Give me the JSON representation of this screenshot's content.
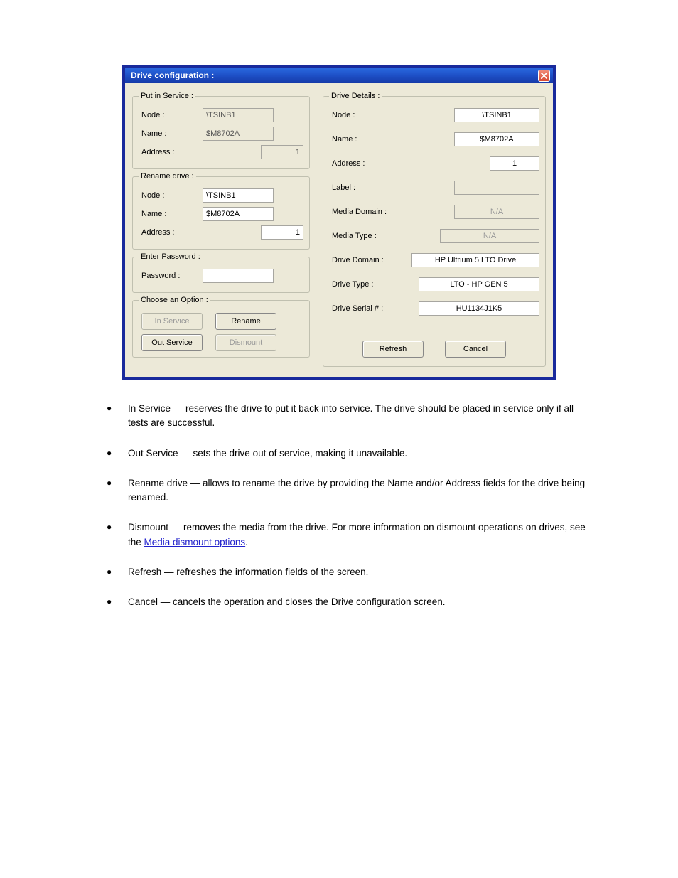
{
  "dialog": {
    "title": "Drive configuration :",
    "putInService": {
      "legend": "Put in Service :",
      "nodeLabel": "Node :",
      "nodeValue": "\\TSINB1",
      "nameLabel": "Name :",
      "nameValue": "$M8702A",
      "addressLabel": "Address :",
      "addressValue": "1"
    },
    "renameDrive": {
      "legend": "Rename drive :",
      "nodeLabel": "Node :",
      "nodeValue": "\\TSINB1",
      "nameLabel": "Name :",
      "nameValue": "$M8702A",
      "addressLabel": "Address :",
      "addressValue": "1"
    },
    "enterPassword": {
      "legend": "Enter Password :",
      "passwordLabel": "Password :",
      "passwordValue": ""
    },
    "chooseOption": {
      "legend": "Choose an Option :",
      "inService": "In Service",
      "rename": "Rename",
      "outService": "Out Service",
      "dismount": "Dismount"
    },
    "driveDetails": {
      "legend": "Drive Details :",
      "nodeLabel": "Node :",
      "nodeValue": "\\TSINB1",
      "nameLabel": "Name :",
      "nameValue": "$M8702A",
      "addressLabel": "Address :",
      "addressValue": "1",
      "labelLabel": "Label :",
      "labelValue": "",
      "mediaDomainLabel": "Media Domain :",
      "mediaDomainValue": "N/A",
      "mediaTypeLabel": "Media Type :",
      "mediaTypeValue": "N/A",
      "driveDomainLabel": "Drive Domain :",
      "driveDomainValue": "HP Ultrium 5 LTO Drive",
      "driveTypeLabel": "Drive Type :",
      "driveTypeValue": "LTO - HP GEN 5",
      "driveSerialLabel": "Drive Serial # :",
      "driveSerialValue": "HU1134J1K5",
      "refresh": "Refresh",
      "cancel": "Cancel"
    }
  },
  "doc": {
    "b1a": "In Service — reserves the drive to put it back into service. The drive should be placed in service only if all tests are successful.",
    "b2a": "Out Service — sets the drive out of service, making it unavailable.",
    "b3a": "Rename drive — allows to rename the drive by providing the Name and/or Address fields for the drive being renamed.",
    "b4a": "Dismount — removes the media from the drive. For more information on dismount operations on drives, see the ",
    "b4link": "Media dismount options",
    "b4b": ".",
    "b5a": "Refresh — refreshes the information fields of the screen.",
    "b6a": "Cancel — cancels the operation and closes the Drive configuration screen."
  }
}
